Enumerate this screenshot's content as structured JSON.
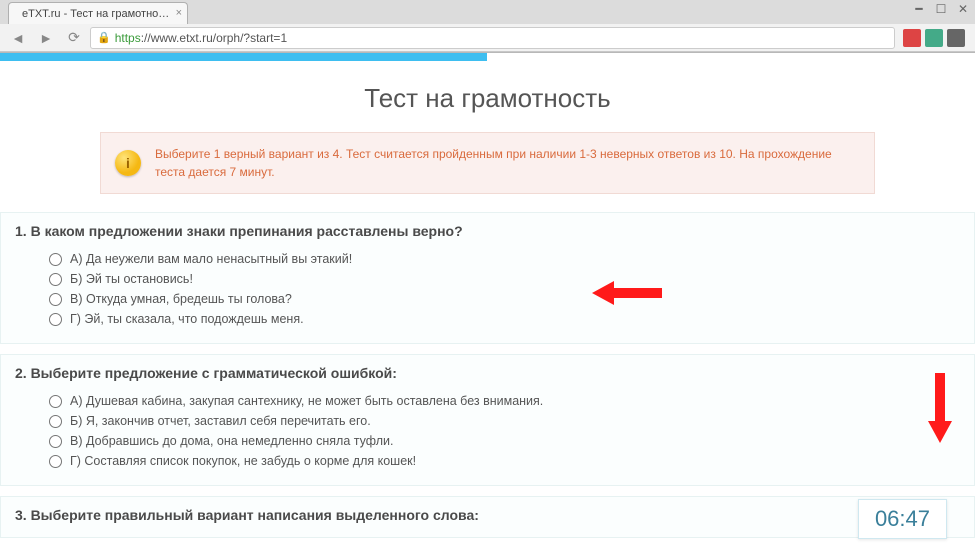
{
  "browser": {
    "tab_title": "eTXT.ru - Тест на грамотно…",
    "url_prefix": "https",
    "url_rest": "://www.etxt.ru/orph/?start=1"
  },
  "page": {
    "title": "Тест на грамотность",
    "alert": "Выберите 1 верный вариант из 4. Тест считается пройденным при наличии 1-3 неверных ответов из 10. На прохождение теста дается 7 минут."
  },
  "questions": [
    {
      "title": "1. В каком предложении знаки препинания расставлены верно?",
      "answers": [
        "А) Да неужели вам мало ненасытный вы этакий!",
        "Б) Эй ты остановись!",
        "В) Откуда умная, бредешь ты голова?",
        "Г) Эй, ты сказала, что подождешь меня."
      ]
    },
    {
      "title": "2. Выберите предложение с грамматической ошибкой:",
      "answers": [
        "А) Душевая кабина, закупая сантехнику, не может быть оставлена без внимания.",
        "Б) Я, закончив отчет, заставил себя перечитать его.",
        "В) Добравшись до дома, она немедленно сняла туфли.",
        "Г) Составляя список покупок, не забудь о корме для кошек!"
      ]
    },
    {
      "title": "3. Выберите правильный вариант написания выделенного слова:",
      "answers": []
    }
  ],
  "timer": "06:47"
}
